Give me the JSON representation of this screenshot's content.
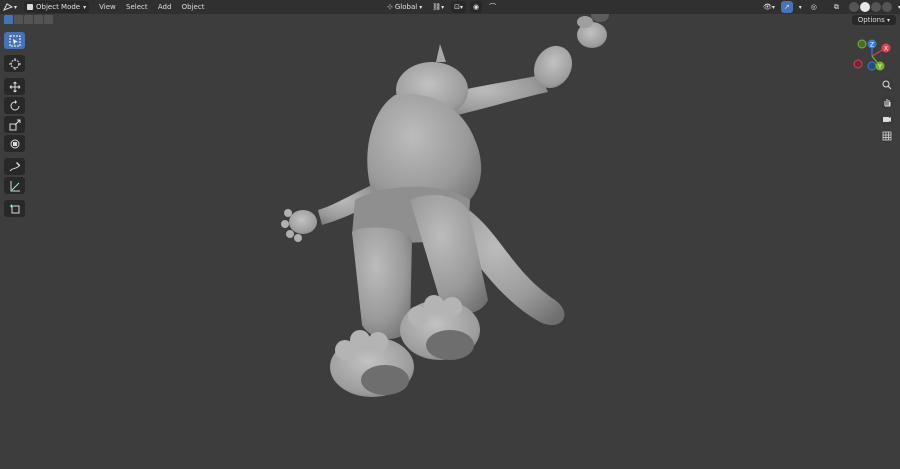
{
  "header": {
    "mode_label": "Object Mode",
    "menu": [
      "View",
      "Select",
      "Add",
      "Object"
    ],
    "orientation_label": "Global",
    "options_label": "Options"
  },
  "gizmo": {
    "axis_x": "X",
    "axis_y": "Y",
    "axis_z": "Z",
    "colors": {
      "x": "#e04050",
      "y": "#76b52a",
      "z": "#3a78d6"
    }
  },
  "toolbar": {
    "tools": [
      "select-box",
      "cursor",
      "move",
      "rotate",
      "scale",
      "transform",
      "annotate",
      "measure",
      "add-cube"
    ]
  },
  "viewport": {
    "background": "#3d3d3d",
    "model": "grey cat character, posed lying on back"
  }
}
